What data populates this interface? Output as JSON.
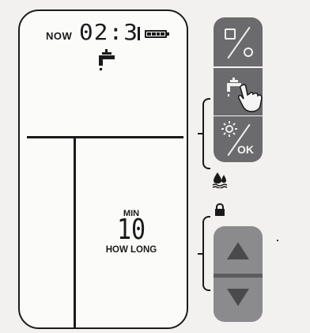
{
  "display": {
    "now_label": "NOW",
    "clock_time": "02:3",
    "battery": "full",
    "duration_unit": "MIN",
    "duration_value": "10",
    "duration_caption": "HOW LONG"
  },
  "buttons": {
    "top_icon": "lcd-power-icon",
    "middle_icon": "tap-hand-icon",
    "ok_label": "OK"
  },
  "icons": {
    "drop": "water-drop-icon",
    "lock": "lock-icon"
  },
  "colors": {
    "button_dark": "#6b6b6d",
    "button_light": "#8b8b8d",
    "ink": "#1a1a1a"
  }
}
